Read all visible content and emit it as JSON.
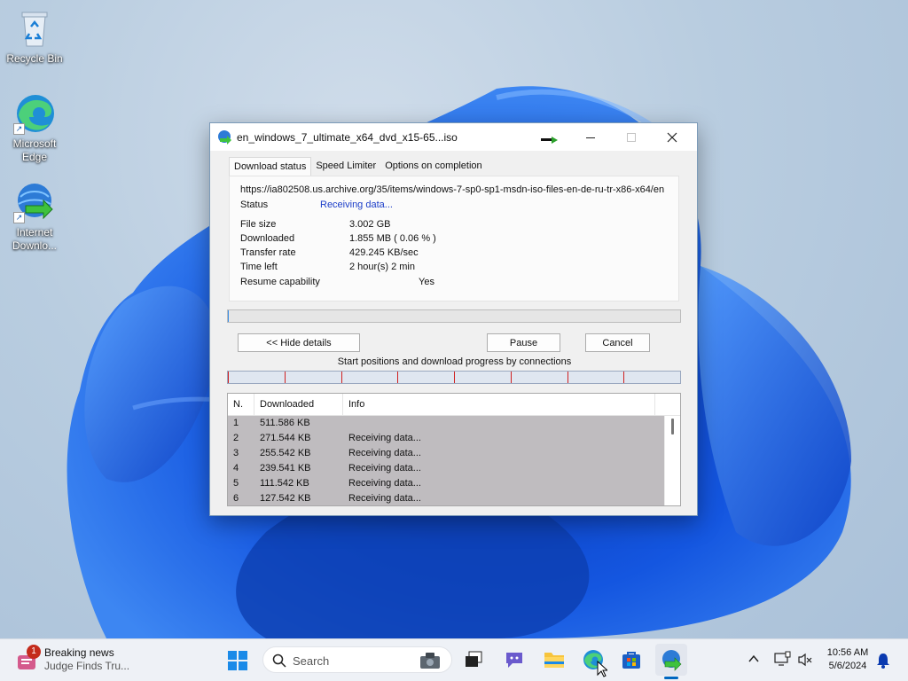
{
  "desktop": {
    "icons": [
      {
        "label": "Recycle Bin",
        "icon": "recycle-bin-icon"
      },
      {
        "label": "Microsoft Edge",
        "icon": "edge-icon"
      },
      {
        "label": "Internet Downlo...",
        "icon": "idm-icon"
      }
    ]
  },
  "dialog": {
    "title": "en_windows_7_ultimate_x64_dvd_x15-65...iso",
    "tabs": [
      "Download status",
      "Speed Limiter",
      "Options on completion"
    ],
    "active_tab": "Download status",
    "url": "https://ia802508.us.archive.org/35/items/windows-7-sp0-sp1-msdn-iso-files-en-de-ru-tr-x86-x64/en",
    "status_label": "Status",
    "status_value": "Receiving data...",
    "file_size_label": "File size",
    "file_size_value": "3.002  GB",
    "downloaded_label": "Downloaded",
    "downloaded_value": "1.855  MB  ( 0.06 % )",
    "transfer_rate_label": "Transfer rate",
    "transfer_rate_value": "429.245  KB/sec",
    "time_left_label": "Time left",
    "time_left_value": "2 hour(s) 2 min",
    "resume_label": "Resume capability",
    "resume_value": "Yes",
    "progress_fraction": 0.0006,
    "hide_details_label": "<< Hide details",
    "pause_label": "Pause",
    "cancel_label": "Cancel",
    "connections_caption": "Start positions and download progress by connections",
    "connection_count": 8,
    "table": {
      "columns": [
        "N.",
        "Downloaded",
        "Info"
      ],
      "rows": [
        {
          "n": "1",
          "downloaded": "511.586  KB",
          "info": ""
        },
        {
          "n": "2",
          "downloaded": "271.544  KB",
          "info": "Receiving data..."
        },
        {
          "n": "3",
          "downloaded": "255.542  KB",
          "info": "Receiving data..."
        },
        {
          "n": "4",
          "downloaded": "239.541  KB",
          "info": "Receiving data..."
        },
        {
          "n": "5",
          "downloaded": "111.542  KB",
          "info": "Receiving data..."
        },
        {
          "n": "6",
          "downloaded": "127.542  KB",
          "info": "Receiving data..."
        }
      ]
    },
    "colors": {
      "status_text": "#1a3cc8",
      "conn_tick": "#d02020",
      "rows_bg": "#bfbcbf"
    }
  },
  "taskbar": {
    "news_badge": "1",
    "news_title": "Breaking news",
    "news_subtitle": "Judge Finds Tru...",
    "search_placeholder": "Search",
    "time": "10:56 AM",
    "date": "5/6/2024",
    "apps": [
      "start-icon",
      "task-view-icon",
      "teams-chat-icon",
      "file-explorer-icon",
      "edge-icon",
      "store-icon",
      "idm-icon"
    ],
    "accent": "#0067c0"
  }
}
